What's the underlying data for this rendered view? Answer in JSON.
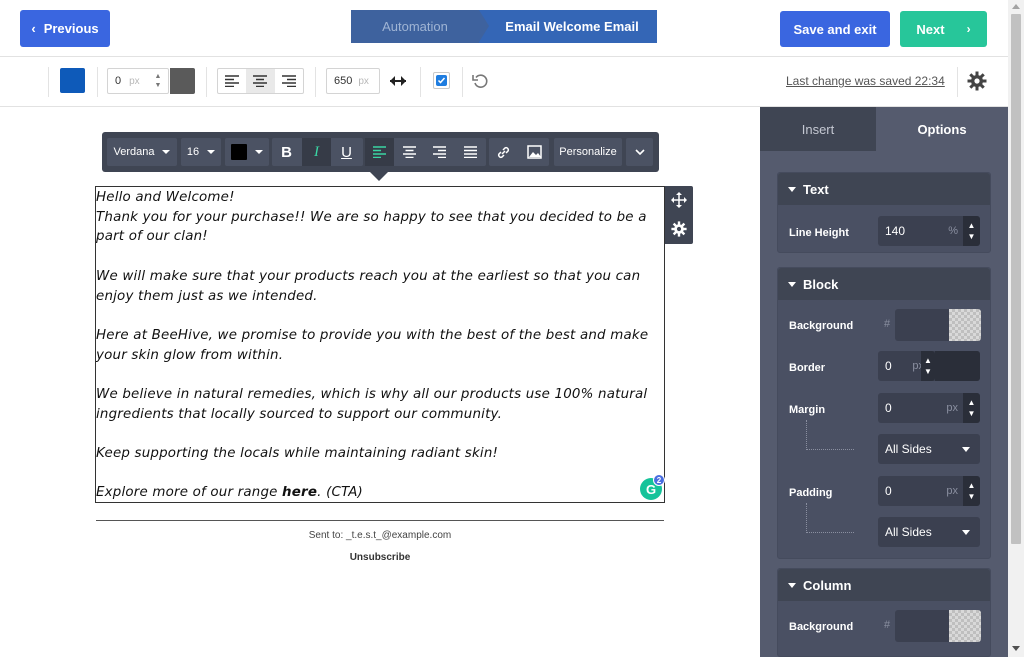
{
  "header": {
    "previous_label": "Previous",
    "breadcrumb": [
      "Automation",
      "Email Welcome Email"
    ],
    "save_exit_label": "Save and exit",
    "next_label": "Next"
  },
  "toolbar": {
    "border_width": "0",
    "border_unit": "px",
    "content_width": "650",
    "content_width_unit": "px",
    "last_saved": "Last change was saved 22:34",
    "bg_color": "#0e5ab9",
    "border_color": "#5a5a5a"
  },
  "format_toolbar": {
    "font": "Verdana",
    "size": "16",
    "text_color": "#000000",
    "personalize_label": "Personalize"
  },
  "email": {
    "lines": [
      "Hello and Welcome!",
      "Thank you for your purchase!! We are so happy to see that you decided to be a",
      "part of our clan!",
      "",
      "We will make sure that your products reach you at the earliest so that you can",
      "enjoy them just as we intended.",
      "",
      "Here at BeeHive, we promise to provide you with the best of the best and make",
      "your skin glow from within.",
      "",
      "We believe in natural remedies, which is why all our products use 100% natural",
      "ingredients that locally sourced to support our community.",
      "",
      "Keep supporting the locals while maintaining radiant skin!",
      ""
    ],
    "last_line_prefix": "Explore more of our range ",
    "last_line_bold": "here",
    "last_line_suffix": ". (CTA)",
    "grammarly_count": "2",
    "sent_to": "Sent to: _t.e.s.t_@example.com",
    "unsubscribe": "Unsubscribe"
  },
  "panel": {
    "tabs": [
      "Insert",
      "Options"
    ],
    "text_section": {
      "title": "Text",
      "line_height_label": "Line Height",
      "line_height_value": "140",
      "line_height_unit": "%"
    },
    "block_section": {
      "title": "Block",
      "background_label": "Background",
      "hash": "#",
      "border_label": "Border",
      "border_value": "0",
      "border_unit": "px",
      "margin_label": "Margin",
      "margin_value": "0",
      "margin_unit": "px",
      "margin_sides": "All Sides",
      "padding_label": "Padding",
      "padding_value": "0",
      "padding_unit": "px",
      "padding_sides": "All Sides"
    },
    "column_section": {
      "title": "Column",
      "background_label": "Background",
      "hash": "#"
    }
  }
}
